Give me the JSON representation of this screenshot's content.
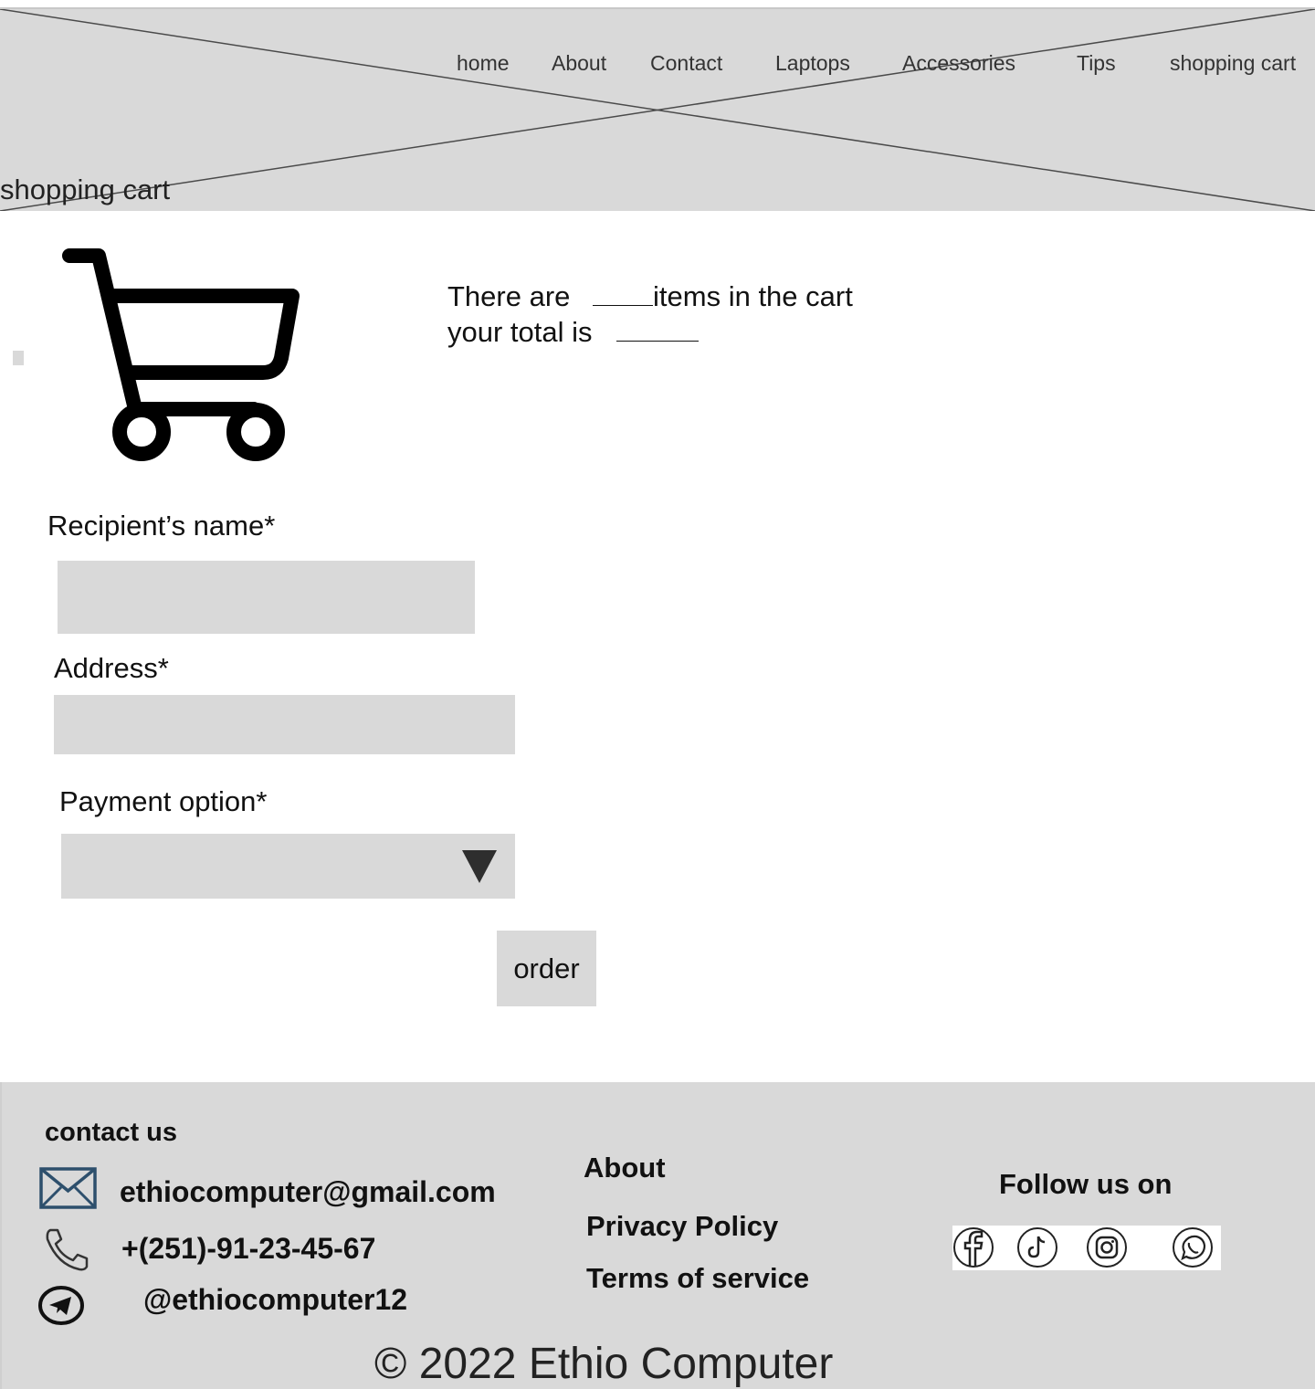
{
  "header": {
    "nav": [
      "home",
      "About",
      "Contact",
      "Laptops",
      "Accessories",
      "Tips",
      "shopping cart"
    ],
    "page_title": "shopping cart"
  },
  "cart_summary": {
    "items_prefix": "There are",
    "items_suffix": "items in the cart",
    "total_prefix": "your total is"
  },
  "form": {
    "recipient_label": "Recipient’s name*",
    "recipient_value": "",
    "address_label": "Address*",
    "address_value": "",
    "payment_label": "Payment option*",
    "payment_value": "",
    "order_label": "order"
  },
  "footer": {
    "contact_heading": "contact us",
    "email": "ethiocomputer@gmail.com",
    "phone": "+(251)-91-23-45-67",
    "telegram": "@ethiocomputer12",
    "about": "About",
    "privacy": "Privacy Policy",
    "terms": "Terms of service",
    "follow": "Follow us on",
    "social_icons": [
      "facebook-icon",
      "tiktok-icon",
      "instagram-icon",
      "whatsapp-icon"
    ],
    "copyright": "© 2022 Ethio Computer"
  }
}
